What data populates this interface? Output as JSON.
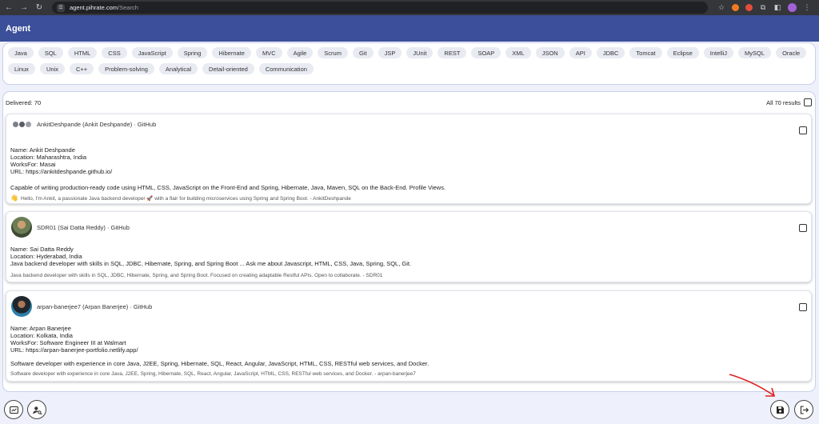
{
  "browser": {
    "url_host": "agent.pihrate.com",
    "url_path": "/Search"
  },
  "app": {
    "title": "Agent"
  },
  "skills": [
    "Java",
    "SQL",
    "HTML",
    "CSS",
    "JavaScript",
    "Spring",
    "Hibernate",
    "MVC",
    "Agile",
    "Scrum",
    "Git",
    "JSP",
    "JUnit",
    "REST",
    "SOAP",
    "XML",
    "JSON",
    "API",
    "JDBC",
    "Tomcat",
    "Eclipse",
    "IntelliJ",
    "MySQL",
    "Oracle",
    "Linux",
    "Unix",
    "C++",
    "Problem-solving",
    "Analytical",
    "Detail-oriented",
    "Communication"
  ],
  "results": {
    "delivered_label": "Delivered: 70",
    "all_label": "All 70 results",
    "cards": [
      {
        "title": "AnkitDeshpande (Ankit Deshpande) · GitHub",
        "lines": [
          "Name: Ankit Deshpande",
          "Location: Maharashtra, India",
          "WorksFor: Masai",
          "URL: https://ankitdeshpande.github.io/"
        ],
        "description": "Capable of writing production-ready code using HTML, CSS, JavaScript on the Front-End and Spring, Hibernate, Java, Maven, SQL on the Back-End. Profile Views.",
        "snippet_emoji": "👋",
        "snippet": "Hello, I'm Ankit, a passionate Java backend developer 🚀 with a flair for building microservices using Spring and Spring Boot. - AnkitDeshpande"
      },
      {
        "title": "SDR01 (Sai Datta Reddy) · GitHub",
        "lines": [
          "Name: Sai Datta Reddy",
          "Location: Hyderabad, India",
          "Java backend developer with skills in SQL, JDBC, Hibernate, Spring, and Spring Boot ... Ask me about Javascript, HTML, CSS, Java, Spring, SQL, Git."
        ],
        "description": "",
        "snippet_emoji": "",
        "snippet": "Java backend developer with skills in SQL, JDBC, Hibernate, Spring, and Spring Boot. Focused on creating adaptable Restful APIs. Open to collaborate. - SDR01"
      },
      {
        "title": "arpan-banerjee7 (Arpan Banerjee) · GitHub",
        "lines": [
          "Name: Arpan Banerjee",
          "Location: Kolkata, India",
          "WorksFor: Software Engineer III at Walmart",
          "URL: https://arpan-banerjee-portfolio.netlify.app/"
        ],
        "description": "Software developer with experience in core Java, J2EE, Spring, Hibernate, SQL, React, Angular, JavaScript, HTML, CSS, RESTful web services, and Docker.",
        "snippet_emoji": "",
        "snippet": "Software developer with experience in core Java, J2EE, Spring, Hibernate, SQL, React, Angular, JavaScript, HTML, CSS, RESTful web services, and Docker. - arpan-banerjee7"
      }
    ]
  },
  "icons": {
    "bottom_left": [
      "dashboard-icon",
      "user-search-icon"
    ],
    "bottom_right": [
      "save-icon",
      "logout-icon"
    ]
  },
  "colors": {
    "header": "#3b4f9a",
    "annotation": "#e02020"
  }
}
